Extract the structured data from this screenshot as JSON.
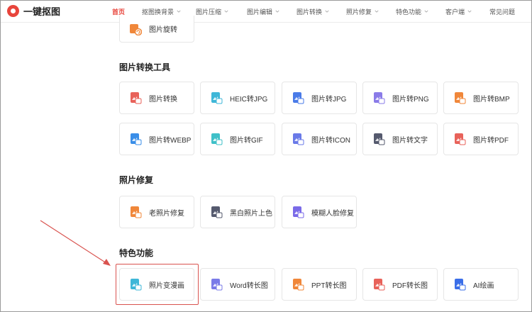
{
  "brand": {
    "name": "一键抠图",
    "color": "#e8453c"
  },
  "nav": {
    "items": [
      {
        "label": "首页",
        "active": true,
        "dropdown": false
      },
      {
        "label": "抠图换背景",
        "active": false,
        "dropdown": true
      },
      {
        "label": "图片压缩",
        "active": false,
        "dropdown": true
      },
      {
        "label": "图片编辑",
        "active": false,
        "dropdown": true
      },
      {
        "label": "图片转换",
        "active": false,
        "dropdown": true
      },
      {
        "label": "照片修复",
        "active": false,
        "dropdown": true
      },
      {
        "label": "特色功能",
        "active": false,
        "dropdown": true
      },
      {
        "label": "客户端",
        "active": false,
        "dropdown": true
      },
      {
        "label": "常见问题",
        "active": false,
        "dropdown": false
      }
    ]
  },
  "partial": {
    "label": "图片旋转",
    "icon": "rotate-image-icon"
  },
  "sections": {
    "convert": {
      "title": "图片转换工具",
      "items": [
        {
          "label": "图片转换",
          "icon": "image-convert-icon",
          "color": "#e8625a"
        },
        {
          "label": "HEIC转JPG",
          "icon": "heic-jpg-icon",
          "color": "#3fb7d8"
        },
        {
          "label": "图片转JPG",
          "icon": "jpg-icon",
          "color": "#4a7be8"
        },
        {
          "label": "图片转PNG",
          "icon": "png-icon",
          "color": "#8a7be8"
        },
        {
          "label": "图片转BMP",
          "icon": "bmp-icon",
          "color": "#f0873a"
        },
        {
          "label": "图片转WEBP",
          "icon": "webp-icon",
          "color": "#3a8ee8"
        },
        {
          "label": "图片转GIF",
          "icon": "gif-icon",
          "color": "#3fc0c8"
        },
        {
          "label": "图片转ICON",
          "icon": "icon-format-icon",
          "color": "#6a7ae8"
        },
        {
          "label": "图片转文字",
          "icon": "image-to-text-icon",
          "color": "#555a6e"
        },
        {
          "label": "图片转PDF",
          "icon": "pdf-icon",
          "color": "#e8625a"
        }
      ]
    },
    "repair": {
      "title": "照片修复",
      "items": [
        {
          "label": "老照片修复",
          "icon": "old-photo-icon",
          "color": "#f0873a"
        },
        {
          "label": "黑白照片上色",
          "icon": "palette-icon",
          "color": "#555a6e"
        },
        {
          "label": "模糊人脸修复",
          "icon": "face-repair-icon",
          "color": "#7a6ae8"
        }
      ]
    },
    "special": {
      "title": "特色功能",
      "items": [
        {
          "label": "照片变漫画",
          "icon": "cartoon-icon",
          "color": "#3fb7d8"
        },
        {
          "label": "Word转长图",
          "icon": "word-long-image-icon",
          "color": "#7a7be8"
        },
        {
          "label": "PPT转长图",
          "icon": "ppt-long-image-icon",
          "color": "#f0873a"
        },
        {
          "label": "PDF转长图",
          "icon": "pdf-long-image-icon",
          "color": "#e8625a"
        },
        {
          "label": "AI绘画",
          "icon": "ai-draw-icon",
          "color": "#3a6ee8"
        }
      ]
    }
  },
  "annotation": {
    "color": "#d9534f"
  }
}
